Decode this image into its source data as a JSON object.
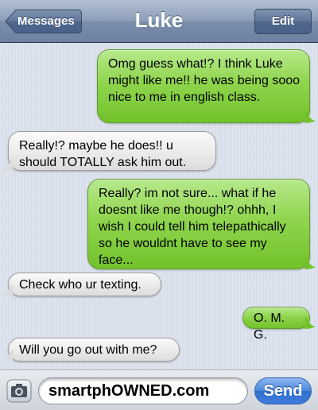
{
  "navbar": {
    "back_label": "Messages",
    "title": "Luke",
    "edit_label": "Edit"
  },
  "messages": [
    {
      "direction": "sent",
      "text": "Omg guess what!? I think Luke might like me!! he was being sooo nice to me in english class."
    },
    {
      "direction": "received",
      "text": "Really!? maybe he does!! u should TOTALLY ask him out."
    },
    {
      "direction": "sent",
      "text": "Really? im not sure... what if he doesnt like me though!? ohhh, I wish I could tell him telepathically so he wouldnt have to see my face..."
    },
    {
      "direction": "received",
      "text": "Check who ur texting."
    },
    {
      "direction": "sent",
      "text": "O. M. G."
    },
    {
      "direction": "received",
      "text": "Will you go out with me?"
    }
  ],
  "input": {
    "value": "smartphOWNED.com",
    "camera_icon": "camera-icon",
    "send_label": "Send"
  },
  "colors": {
    "sent_bubble": "#8fd54d",
    "received_bubble": "#ececec",
    "thread_background": "#dbe2ed",
    "send_button": "#3e7ddb"
  }
}
